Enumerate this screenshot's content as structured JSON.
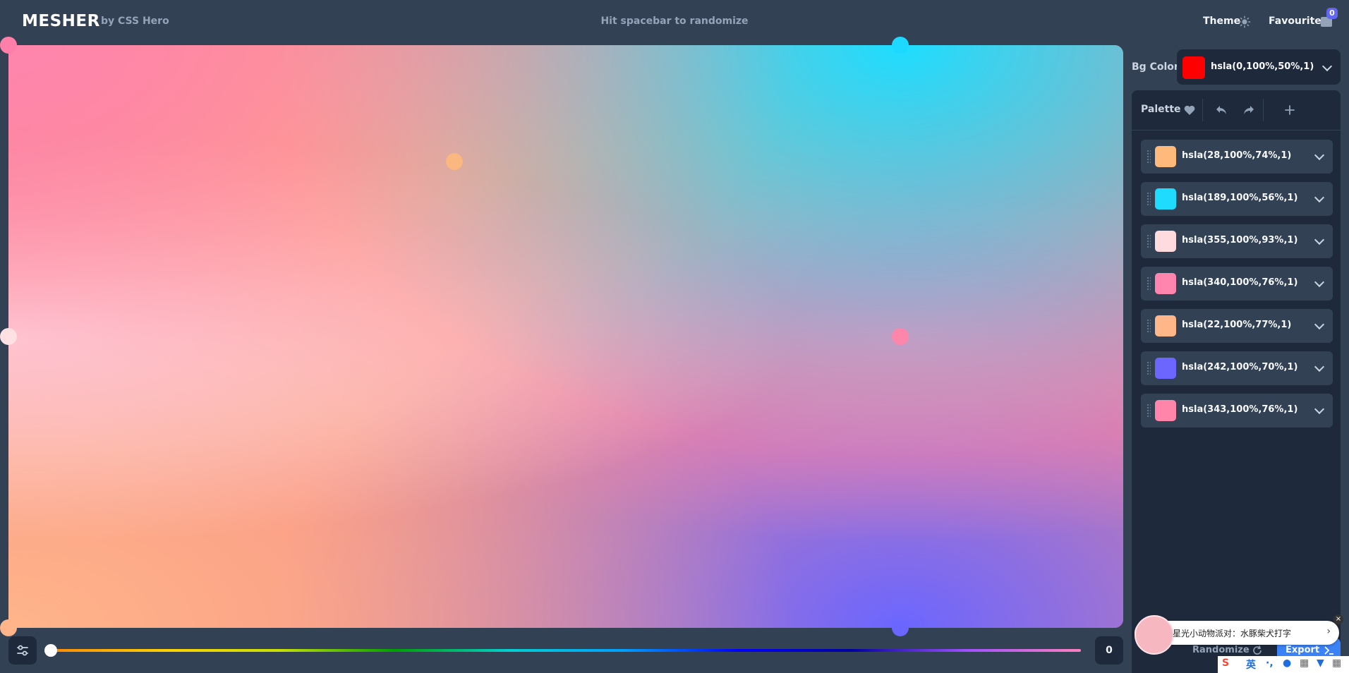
{
  "header": {
    "logo": "MESHER",
    "byline": "by CSS Hero",
    "hint": "Hit spacebar to randomize",
    "theme_label": "Theme",
    "theme_icon": "sun-icon",
    "favourites_label": "Favourites",
    "favourites_count": "0"
  },
  "canvas": {
    "bg_color": "hsla(0,100%,50%,1)",
    "handle_colors": [
      "#ff7fa8",
      "#1ed9ff",
      "#ffe0e3",
      "#ff86ab",
      "#ffb48a",
      "#6a66ff",
      "#ffba7a"
    ]
  },
  "hue_slider": {
    "value": "0"
  },
  "sidebar": {
    "bg_label": "Bg Color",
    "bg_value": "hsla(0,100%,50%,1)",
    "bg_swatch": "#ff0000",
    "palette_label": "Palette",
    "palette_icons": [
      "heart-icon",
      "undo-icon",
      "redo-icon",
      "plus-icon"
    ],
    "colors": [
      {
        "value": "hsla(28,100%,74%,1)",
        "swatch": "#ffb97b"
      },
      {
        "value": "hsla(189,100%,56%,1)",
        "swatch": "#1fdcff"
      },
      {
        "value": "hsla(355,100%,93%,1)",
        "swatch": "#ffdbdf"
      },
      {
        "value": "hsla(340,100%,76%,1)",
        "swatch": "#ff85ae"
      },
      {
        "value": "hsla(22,100%,77%,1)",
        "swatch": "#ffb78a"
      },
      {
        "value": "hsla(242,100%,70%,1)",
        "swatch": "#6c66ff"
      },
      {
        "value": "hsla(343,100%,76%,1)",
        "swatch": "#ff85aa"
      }
    ]
  },
  "actions": {
    "randomize_label": "Randomize",
    "export_label": "Export"
  },
  "overlay": {
    "popup_text": "星光小动物派对：水豚柴犬打字",
    "tray_items": [
      "S",
      "英",
      "·,",
      "mic",
      "kbd",
      "shirt",
      "grid"
    ]
  }
}
